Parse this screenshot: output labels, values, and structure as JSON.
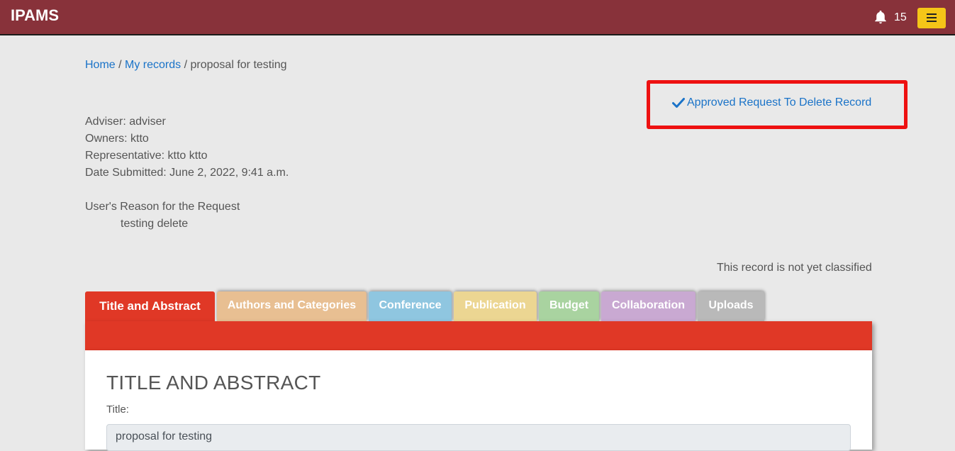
{
  "navbar": {
    "brand": "IPAMS",
    "notification_count": "15",
    "colors": {
      "bar": "#88323a",
      "menu_button": "#f5c518"
    }
  },
  "breadcrumb": {
    "home": "Home",
    "sep1": " / ",
    "my_records": "My records",
    "sep2": " / ",
    "current": "proposal for testing"
  },
  "request": {
    "approved_label": "Approved Request To Delete Record",
    "highlight_color": "#ee1111"
  },
  "info": {
    "adviser": "Adviser: adviser",
    "owners": "Owners: ktto",
    "representative": "Representative: ktto ktto",
    "date_submitted": "Date Submitted: June 2, 2022, 9:41 a.m."
  },
  "reason": {
    "heading": "User's Reason for the Request",
    "text": "testing delete"
  },
  "classification": "This record is not yet classified",
  "tabs": [
    {
      "label": "Title and Abstract",
      "color": "#e03826"
    },
    {
      "label": "Authors and Categories",
      "color": "#e8bf92"
    },
    {
      "label": "Conference",
      "color": "#8fc6e0"
    },
    {
      "label": "Publication",
      "color": "#ecd692"
    },
    {
      "label": "Budget",
      "color": "#a9d3a0"
    },
    {
      "label": "Collaboration",
      "color": "#c9a9d2"
    },
    {
      "label": "Uploads",
      "color": "#b9b9b9"
    }
  ],
  "panel": {
    "heading": "TITLE AND ABSTRACT",
    "title_label": "Title:",
    "title_value": "proposal for testing"
  }
}
